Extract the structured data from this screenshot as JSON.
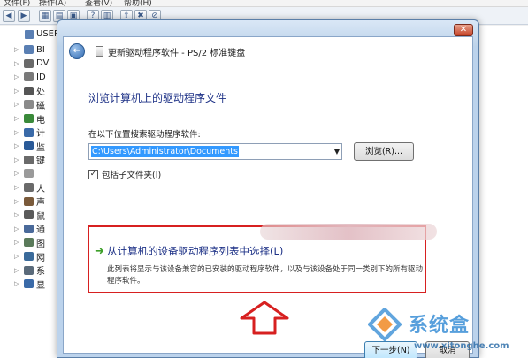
{
  "menubar": {
    "file": "文件(F)",
    "action": "操作(A)",
    "view": "查看(V)",
    "help": "帮助(H)"
  },
  "tree": {
    "root_label": "USER",
    "items": [
      {
        "label": "BI",
        "color": "#5a7fb3"
      },
      {
        "label": "DV",
        "color": "#6a6a6a"
      },
      {
        "label": "ID",
        "color": "#7a7a7a"
      },
      {
        "label": "处",
        "color": "#555555"
      },
      {
        "label": "磁",
        "color": "#8a8a8a"
      },
      {
        "label": "电",
        "color": "#3a8a3a"
      },
      {
        "label": "计",
        "color": "#3a6aa8"
      },
      {
        "label": "监",
        "color": "#2a5a98"
      },
      {
        "label": "键",
        "color": "#6a6a6a"
      },
      {
        "label": "",
        "color": "#9a9a9a"
      },
      {
        "label": "人",
        "color": "#6a6a6a"
      },
      {
        "label": "声",
        "color": "#7a5a3a"
      },
      {
        "label": "鼠",
        "color": "#5a5a5a"
      },
      {
        "label": "通",
        "color": "#4a6a9a"
      },
      {
        "label": "图",
        "color": "#5a7a5a"
      },
      {
        "label": "网",
        "color": "#3a6a9a"
      },
      {
        "label": "系",
        "color": "#5a6a7a"
      },
      {
        "label": "显",
        "color": "#3a6aa8"
      }
    ]
  },
  "dialog": {
    "nav_title": "更新驱动程序软件 - PS/2 标准键盘",
    "close_label": "✕",
    "heading": "浏览计算机上的驱动程序文件",
    "search_label": "在以下位置搜索驱动程序软件:",
    "path_value": "C:\\Users\\Administrator\\Documents",
    "browse_label": "浏览(R)...",
    "include_subfolders_label": "包括子文件夹(I)",
    "option_title": "从计算机的设备驱动程序列表中选择(L)",
    "option_desc": "此列表将显示与该设备兼容的已安装的驱动程序软件，以及与该设备处于同一类别下的所有驱动程序软件。",
    "next_label": "下一步(N)",
    "cancel_label": "取消"
  },
  "watermark": {
    "brand": "系统盒",
    "url": "www.xitonghe.com"
  },
  "colors": {
    "heading": "#1e3287",
    "highlight": "#d72020",
    "selection": "#3399ff"
  }
}
